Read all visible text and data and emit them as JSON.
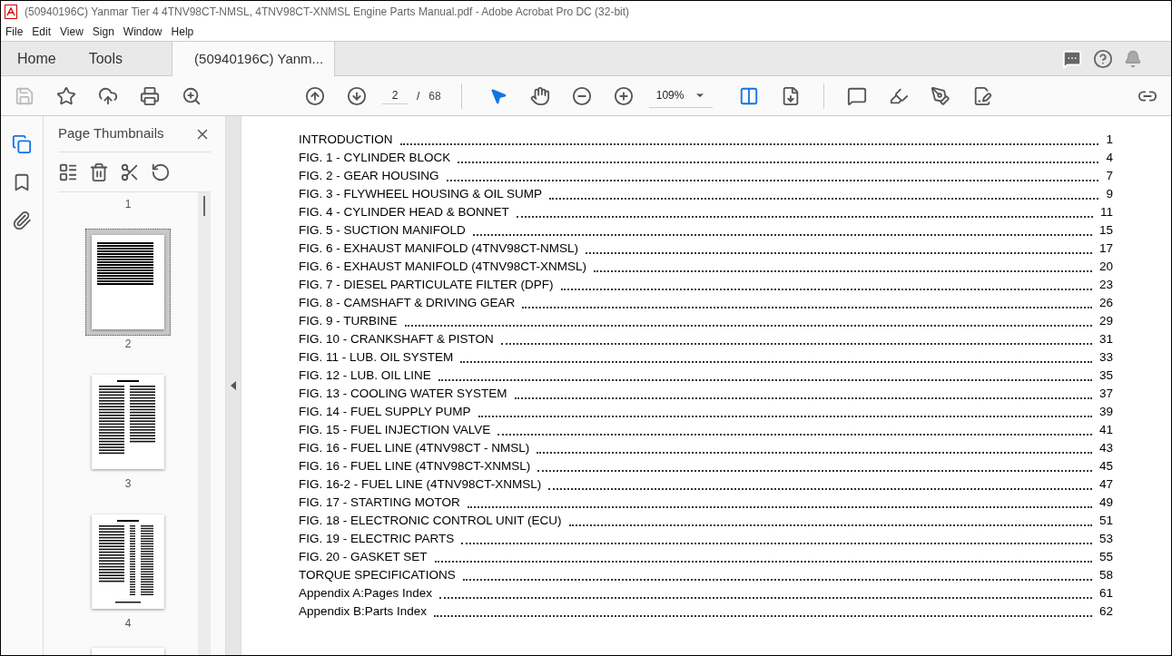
{
  "window": {
    "title": "(50940196C) Yanmar Tier 4 4TNV98CT-NMSL, 4TNV98CT-XNMSL Engine Parts Manual.pdf - Adobe Acrobat Pro DC (32-bit)"
  },
  "menu": [
    "File",
    "Edit",
    "View",
    "Sign",
    "Window",
    "Help"
  ],
  "tabs": [
    {
      "label": "Home",
      "selected": false,
      "kind": "nav"
    },
    {
      "label": "Tools",
      "selected": false,
      "kind": "nav"
    },
    {
      "label": "(50940196C) Yanm...",
      "selected": true,
      "kind": "document"
    }
  ],
  "toolbar": {
    "page": "2",
    "separator": "/",
    "page_count": "68",
    "zoom": "109%"
  },
  "side_panel": {
    "title": "Page Thumbnails",
    "top_label": "1",
    "thumbnails": [
      {
        "label": "2",
        "selected": true,
        "kind": "toc"
      },
      {
        "label": "3",
        "selected": false,
        "kind": "text"
      },
      {
        "label": "4",
        "selected": false,
        "kind": "list"
      }
    ]
  },
  "toc": [
    {
      "title": "INTRODUCTION",
      "page": "1"
    },
    {
      "title": "FIG. 1 - CYLINDER BLOCK",
      "page": "4"
    },
    {
      "title": "FIG. 2 - GEAR HOUSING",
      "page": "7"
    },
    {
      "title": "FIG. 3 - FLYWHEEL HOUSING & OIL SUMP",
      "page": "9"
    },
    {
      "title": "FIG. 4 - CYLINDER HEAD & BONNET",
      "page": "11"
    },
    {
      "title": "FIG. 5 - SUCTION MANIFOLD",
      "page": "15"
    },
    {
      "title": "FIG. 6 - EXHAUST MANIFOLD (4TNV98CT-NMSL)",
      "page": "17"
    },
    {
      "title": "FIG. 6 - EXHAUST MANIFOLD (4TNV98CT-XNMSL)",
      "page": "20"
    },
    {
      "title": "FIG. 7 - DIESEL PARTICULATE FILTER (DPF)",
      "page": "23"
    },
    {
      "title": "FIG. 8 - CAMSHAFT & DRIVING GEAR",
      "page": "26"
    },
    {
      "title": "FIG. 9 - TURBINE",
      "page": "29"
    },
    {
      "title": "FIG. 10 - CRANKSHAFT & PISTON",
      "page": "31"
    },
    {
      "title": "FIG. 11 - LUB. OIL SYSTEM",
      "page": "33"
    },
    {
      "title": "FIG. 12 - LUB. OIL LINE",
      "page": "35"
    },
    {
      "title": "FIG. 13 - COOLING WATER SYSTEM",
      "page": "37"
    },
    {
      "title": "FIG. 14 - FUEL SUPPLY PUMP",
      "page": "39"
    },
    {
      "title": "FIG. 15 - FUEL INJECTION VALVE",
      "page": "41"
    },
    {
      "title": "FIG. 16 - FUEL LINE (4TNV98CT - NMSL)",
      "page": "43"
    },
    {
      "title": "FIG. 16 - FUEL LINE (4TNV98CT-XNMSL)",
      "page": "45"
    },
    {
      "title": "FIG. 16-2 - FUEL LINE (4TNV98CT-XNMSL)",
      "page": "47"
    },
    {
      "title": "FIG. 17 - STARTING MOTOR",
      "page": "49"
    },
    {
      "title": "FIG. 18 - ELECTRONIC CONTROL UNIT (ECU)",
      "page": "51"
    },
    {
      "title": "FIG. 19 - ELECTRIC PARTS",
      "page": "53"
    },
    {
      "title": "FIG. 20 - GASKET SET",
      "page": "55"
    },
    {
      "title": "TORQUE SPECIFICATIONS",
      "page": "58"
    },
    {
      "title": "Appendix A:Pages Index",
      "page": "61"
    },
    {
      "title": "Appendix B:Parts Index",
      "page": "62"
    }
  ]
}
